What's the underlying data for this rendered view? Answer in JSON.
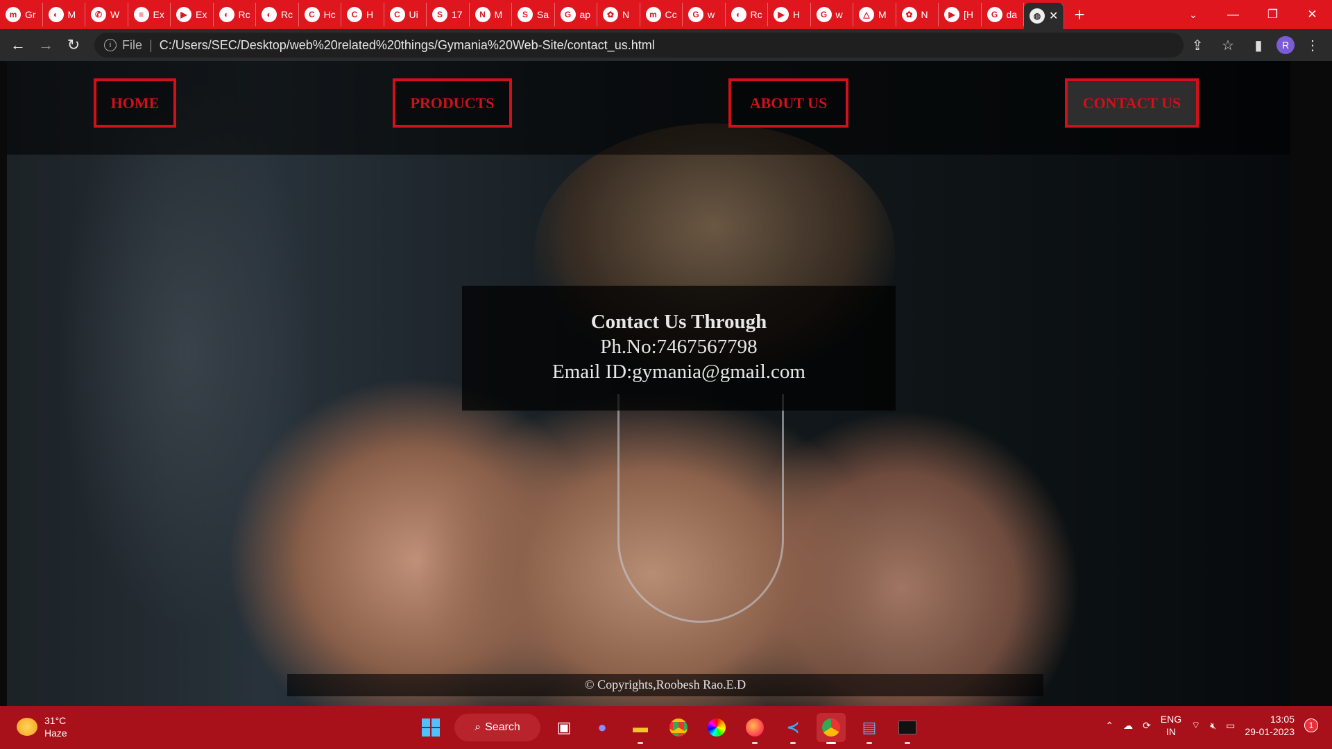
{
  "browser": {
    "tabs": [
      {
        "icon": "mn",
        "label": "Gr"
      },
      {
        "icon": "github",
        "label": "M"
      },
      {
        "icon": "whatsapp",
        "label": "W"
      },
      {
        "icon": "docs",
        "label": "Ex"
      },
      {
        "icon": "youtube",
        "label": "Ex"
      },
      {
        "icon": "github",
        "label": "Rc"
      },
      {
        "icon": "github",
        "label": "Rc"
      },
      {
        "icon": "c",
        "label": "Hc"
      },
      {
        "icon": "c",
        "label": "H"
      },
      {
        "icon": "c",
        "label": "Ui"
      },
      {
        "icon": "s",
        "label": "17"
      },
      {
        "icon": "n",
        "label": "M"
      },
      {
        "icon": "s",
        "label": "Sa"
      },
      {
        "icon": "google",
        "label": "ap"
      },
      {
        "icon": "openai",
        "label": "N"
      },
      {
        "icon": "mn",
        "label": "Cc"
      },
      {
        "icon": "google",
        "label": "w"
      },
      {
        "icon": "github",
        "label": "Rc"
      },
      {
        "icon": "youtube",
        "label": "H"
      },
      {
        "icon": "google",
        "label": "w"
      },
      {
        "icon": "drive",
        "label": "M"
      },
      {
        "icon": "openai",
        "label": "N"
      },
      {
        "icon": "youtube",
        "label": "[H"
      },
      {
        "icon": "google",
        "label": "da"
      }
    ],
    "address": {
      "scheme": "File",
      "url": "C:/Users/SEC/Desktop/web%20related%20things/Gymania%20Web-Site/contact_us.html"
    },
    "profile_initial": "R"
  },
  "site": {
    "nav": [
      "HOME",
      "PRODUCTS",
      "ABOUT US",
      "CONTACT US"
    ],
    "contact": {
      "heading": "Contact Us Through",
      "phone": "Ph.No:7467567798",
      "email": "Email ID:gymania@gmail.com"
    },
    "footer": "© Copyrights,Roobesh Rao.E.D"
  },
  "taskbar": {
    "weather": {
      "temp": "31°C",
      "condition": "Haze"
    },
    "search_label": "Search",
    "apps": [
      "files-icon",
      "meet-icon",
      "explorer-icon",
      "chrome-icon",
      "colorwheel-icon",
      "firefox-icon",
      "vscode-icon",
      "chrome-profile-icon",
      "notepad-icon",
      "terminal-icon"
    ],
    "lang": [
      "ENG",
      "IN"
    ],
    "time": "13:05",
    "date": "29-01-2023",
    "notification_count": "1"
  },
  "colors": {
    "accent_red": "#d0101a",
    "tabstrip": "#e0161f",
    "taskbar": "#a8101a"
  }
}
